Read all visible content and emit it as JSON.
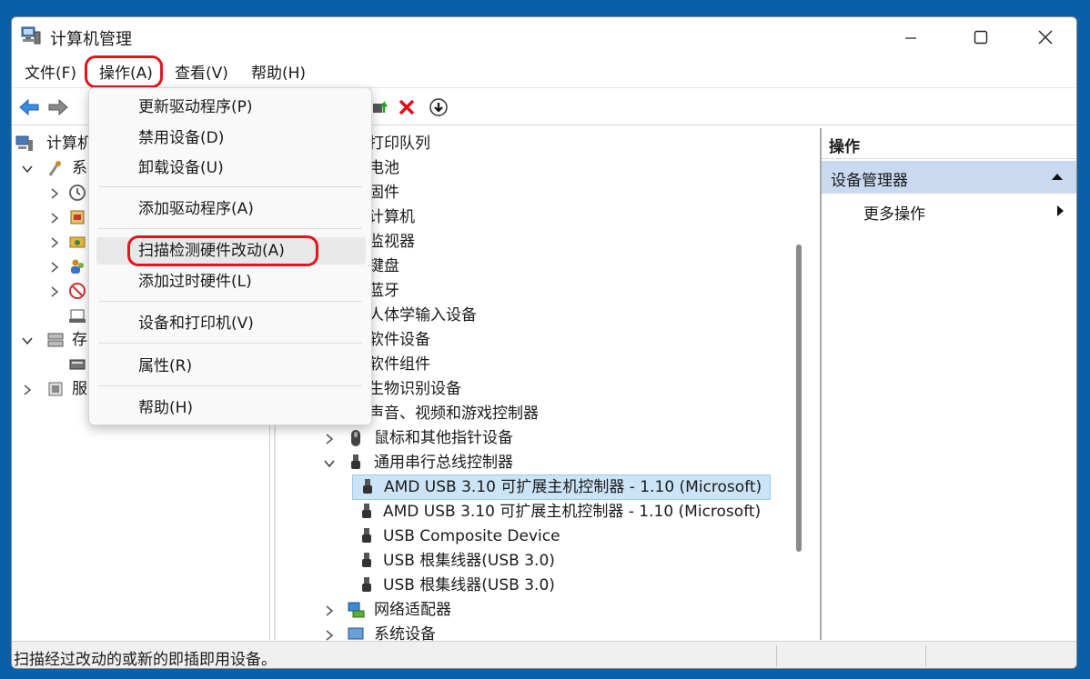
{
  "window": {
    "title": "计算机管理"
  },
  "menubar": {
    "file": "文件(F)",
    "action": "操作(A)",
    "view": "查看(V)",
    "help": "帮助(H)"
  },
  "left_tree": {
    "root_label": "计算机",
    "system_label": "系",
    "storage_label": "存",
    "services_label": "服"
  },
  "devices": {
    "print_queue": "打印队列",
    "battery": "电池",
    "firmware": "固件",
    "computer": "计算机",
    "monitor": "监视器",
    "keyboard": "键盘",
    "bluetooth": "蓝牙",
    "hid": "人体学输入设备",
    "software_device": "软件设备",
    "software_component": "软件组件",
    "biometric": "生物识别设备",
    "audio": "声音、视频和游戏控制器",
    "mouse": "鼠标和其他指针设备",
    "usb_controllers": "通用串行总线控制器",
    "usb_children": [
      "AMD USB 3.10 可扩展主机控制器 - 1.10 (Microsoft)",
      "AMD USB 3.10 可扩展主机控制器 - 1.10 (Microsoft)",
      "USB Composite Device",
      "USB 根集线器(USB 3.0)",
      "USB 根集线器(USB 3.0)"
    ],
    "network": "网络适配器",
    "system": "系统设备"
  },
  "actions_pane": {
    "header": "操作",
    "section": "设备管理器",
    "more": "更多操作"
  },
  "dropdown": {
    "items": [
      "更新驱动程序(P)",
      "禁用设备(D)",
      "卸载设备(U)",
      "添加驱动程序(A)",
      "扫描检测硬件改动(A)",
      "添加过时硬件(L)",
      "设备和打印机(V)",
      "属性(R)",
      "帮助(H)"
    ]
  },
  "statusbar": {
    "text": "扫描经过改动的或新的即插即用设备。"
  },
  "colors": {
    "accent_blue": "#0b5fa8",
    "highlight_red": "#e0151f",
    "section_header_bg": "#c9daf0"
  }
}
